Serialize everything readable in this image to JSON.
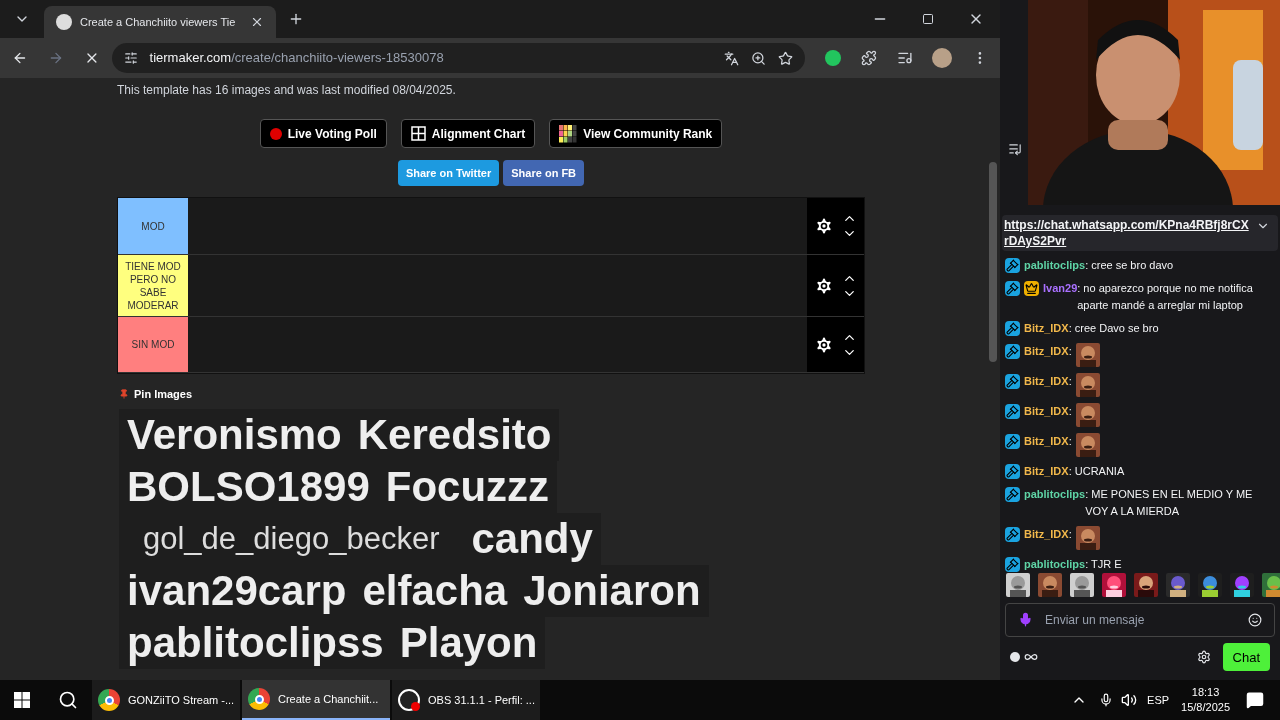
{
  "browser": {
    "tabs": [
      {
        "title": "Create a Chanchiito viewers Tie",
        "selected": true
      }
    ],
    "url_host": "tiermaker.com",
    "url_path": "/create/chanchiito-viewers-18530078"
  },
  "page": {
    "info": "This template has 16 images and was last modified 08/04/2025.",
    "buttons": [
      {
        "label": "Live Voting Poll",
        "kind": "poll"
      },
      {
        "label": "Alignment Chart",
        "kind": "alignment"
      },
      {
        "label": "View Community Rank",
        "kind": "rank"
      }
    ],
    "share": [
      {
        "label": "Share on Twitter",
        "kind": "twitter"
      },
      {
        "label": "Share on FB",
        "kind": "facebook"
      }
    ],
    "tiers": [
      {
        "label": "MOD",
        "color": "#7fbfff"
      },
      {
        "label": "TIENE MOD PERO NO SABE MODERAR",
        "color": "#ffff7f"
      },
      {
        "label": "SIN MOD",
        "color": "#ff7f7f"
      }
    ],
    "pin_label": "Pin Images",
    "image_rows": [
      [
        {
          "label": "Veronismo",
          "kind": "bold"
        },
        {
          "label": "Keredsito",
          "kind": "bold"
        }
      ],
      [
        {
          "label": "BOLSO1899",
          "kind": "bold"
        },
        {
          "label": "Focuzzz",
          "kind": "bold"
        }
      ],
      [
        {
          "label": "gol_de_diego_becker",
          "kind": "light"
        },
        {
          "label": "candy",
          "kind": "bold"
        }
      ],
      [
        {
          "label": "ivan29carp",
          "kind": "bold"
        },
        {
          "label": "elfacha",
          "kind": "bold"
        },
        {
          "label": "Joniaron",
          "kind": "bold"
        }
      ],
      [
        {
          "label": "pablitoclipss",
          "kind": "bold"
        },
        {
          "label": "Playon",
          "kind": "bold"
        }
      ]
    ]
  },
  "chat": {
    "pinned_link": "https://chat.whatsapp.com/KPna4RBfj8rCXrDAyS2Pvr",
    "messages": [
      {
        "user": "pablitoclips",
        "color": "#5fd4a6",
        "crown": false,
        "kind": "text",
        "text": ": cree se bro davo"
      },
      {
        "user": "Ivan29",
        "color": "#a970ff",
        "crown": true,
        "kind": "text",
        "text": ": no aparezco porque no me notifica aparte mandé a arreglar mi laptop"
      },
      {
        "user": "Bitz_IDX",
        "color": "#f2b84b",
        "crown": false,
        "kind": "text",
        "text": ": cree Davo se bro"
      },
      {
        "user": "Bitz_IDX",
        "color": "#f2b84b",
        "crown": false,
        "kind": "emote",
        "text": ":"
      },
      {
        "user": "Bitz_IDX",
        "color": "#f2b84b",
        "crown": false,
        "kind": "emote",
        "text": ":"
      },
      {
        "user": "Bitz_IDX",
        "color": "#f2b84b",
        "crown": false,
        "kind": "emote",
        "text": ":"
      },
      {
        "user": "Bitz_IDX",
        "color": "#f2b84b",
        "crown": false,
        "kind": "emote",
        "text": ":"
      },
      {
        "user": "Bitz_IDX",
        "color": "#f2b84b",
        "crown": false,
        "kind": "text",
        "text": ": UCRANIA"
      },
      {
        "user": "pablitoclips",
        "color": "#5fd4a6",
        "crown": false,
        "kind": "text",
        "text": ": ME PONES EN EL MEDIO Y ME VOY A LA MIERDA"
      },
      {
        "user": "Bitz_IDX",
        "color": "#f2b84b",
        "crown": false,
        "kind": "emote",
        "text": ":"
      },
      {
        "user": "pablitoclips",
        "color": "#5fd4a6",
        "crown": false,
        "kind": "text",
        "text": ": TJR E"
      }
    ],
    "input_placeholder": "Enviar un mensaje",
    "chat_button": "Chat"
  },
  "taskbar": {
    "items": [
      {
        "label": "GONZiiTO Stream -...",
        "kind": "chrome",
        "selected": false
      },
      {
        "label": "Create a Chanchiit...",
        "kind": "chrome",
        "selected": true
      },
      {
        "label": "OBS 31.1.1 - Perfil: ...",
        "kind": "obs",
        "selected": false
      }
    ],
    "lang": "ESP",
    "time": "18:13",
    "date": "15/8/2025"
  }
}
